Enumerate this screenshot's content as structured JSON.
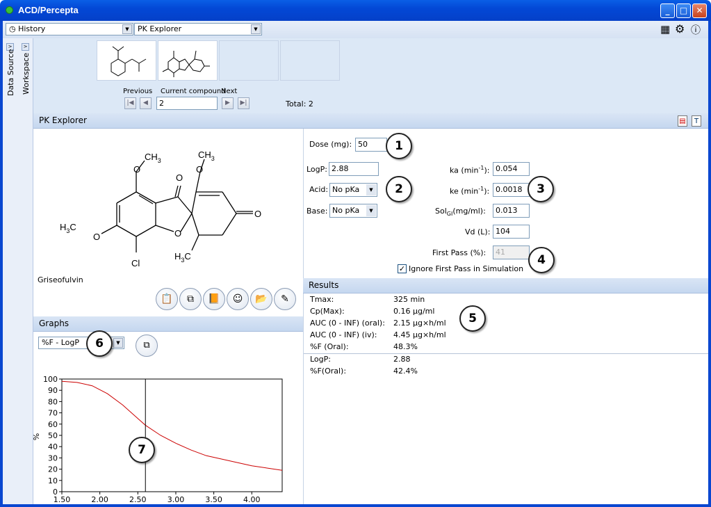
{
  "window": {
    "title": "ACD/Percepta"
  },
  "toolbar": {
    "history_label": "History",
    "module_label": "PK Explorer"
  },
  "side_tabs": {
    "data_source": "Data Source",
    "workspace": "Workspace"
  },
  "navigation": {
    "previous_label": "Previous",
    "current_label": "Current compound",
    "next_label": "Next",
    "current_value": "2",
    "total_text": "Total: 2"
  },
  "pk_panel": {
    "title": "PK Explorer"
  },
  "structure": {
    "name": "Griseofulvin",
    "atom_labels": {
      "ch3_top1": "CH3",
      "ch3_top2": "CH3",
      "o1": "O",
      "o2": "O",
      "o3": "O",
      "o4": "O",
      "o5": "O",
      "o6": "O",
      "h3c_left": "H3C",
      "h3c_bottom": "H3C",
      "cl": "Cl"
    }
  },
  "params": {
    "dose_label": "Dose (mg):",
    "dose_value": "50",
    "logp_label": "LogP:",
    "logp_value": "2.88",
    "acid_label": "Acid:",
    "acid_value": "No pKa",
    "base_label": "Base:",
    "base_value": "No pKa",
    "ka_label": "ka (min-1):",
    "ka_value": "0.054",
    "ke_label": "ke (min-1):",
    "ke_value": "0.0018",
    "sol_label": "SolGI(mg/ml):",
    "sol_value": "0.013",
    "vd_label": "Vd (L):",
    "vd_value": "104",
    "fp_label": "First Pass (%):",
    "fp_value": "41",
    "ignore_fp_label": "Ignore First Pass in Simulation"
  },
  "results": {
    "title": "Results",
    "rows": [
      {
        "label": "Tmax:",
        "value": "325 min"
      },
      {
        "label": "Cp(Max):",
        "value": "0.16 μg/ml"
      },
      {
        "label": "AUC (0 - INF) (oral):",
        "value": "2.15 μg×h/ml"
      },
      {
        "label": "AUC (0 - INF) (iv):",
        "value": "4.45 μg×h/ml"
      },
      {
        "label": "%F (Oral):",
        "value": "48.3%"
      }
    ],
    "rows2": [
      {
        "label": "LogP:",
        "value": "2.88"
      },
      {
        "label": "%F(Oral):",
        "value": "42.4%"
      }
    ]
  },
  "graphs": {
    "title": "Graphs",
    "graph_select": "%F - LogP"
  },
  "badges": [
    "1",
    "2",
    "3",
    "4",
    "5",
    "6",
    "7"
  ],
  "colors": {
    "accent": "#0a47d0",
    "curve": "#cc0000"
  },
  "chart_data": {
    "type": "line",
    "ylabel": "%",
    "xlim": [
      1.5,
      4.4
    ],
    "ylim": [
      0,
      100
    ],
    "x_ticks": [
      "1.50",
      "2.00",
      "2.50",
      "3.00",
      "3.50",
      "4.00"
    ],
    "y_ticks": [
      "0",
      "10",
      "20",
      "30",
      "40",
      "50",
      "60",
      "70",
      "80",
      "90",
      "100"
    ],
    "marker_x": 2.6,
    "x": [
      1.5,
      1.7,
      1.9,
      2.1,
      2.3,
      2.5,
      2.6,
      2.8,
      3.0,
      3.2,
      3.4,
      3.6,
      3.8,
      4.0,
      4.2,
      4.4
    ],
    "y": [
      98,
      97,
      94,
      87,
      77,
      65,
      59,
      50,
      43,
      37,
      32,
      29,
      26,
      23,
      21,
      19
    ]
  }
}
